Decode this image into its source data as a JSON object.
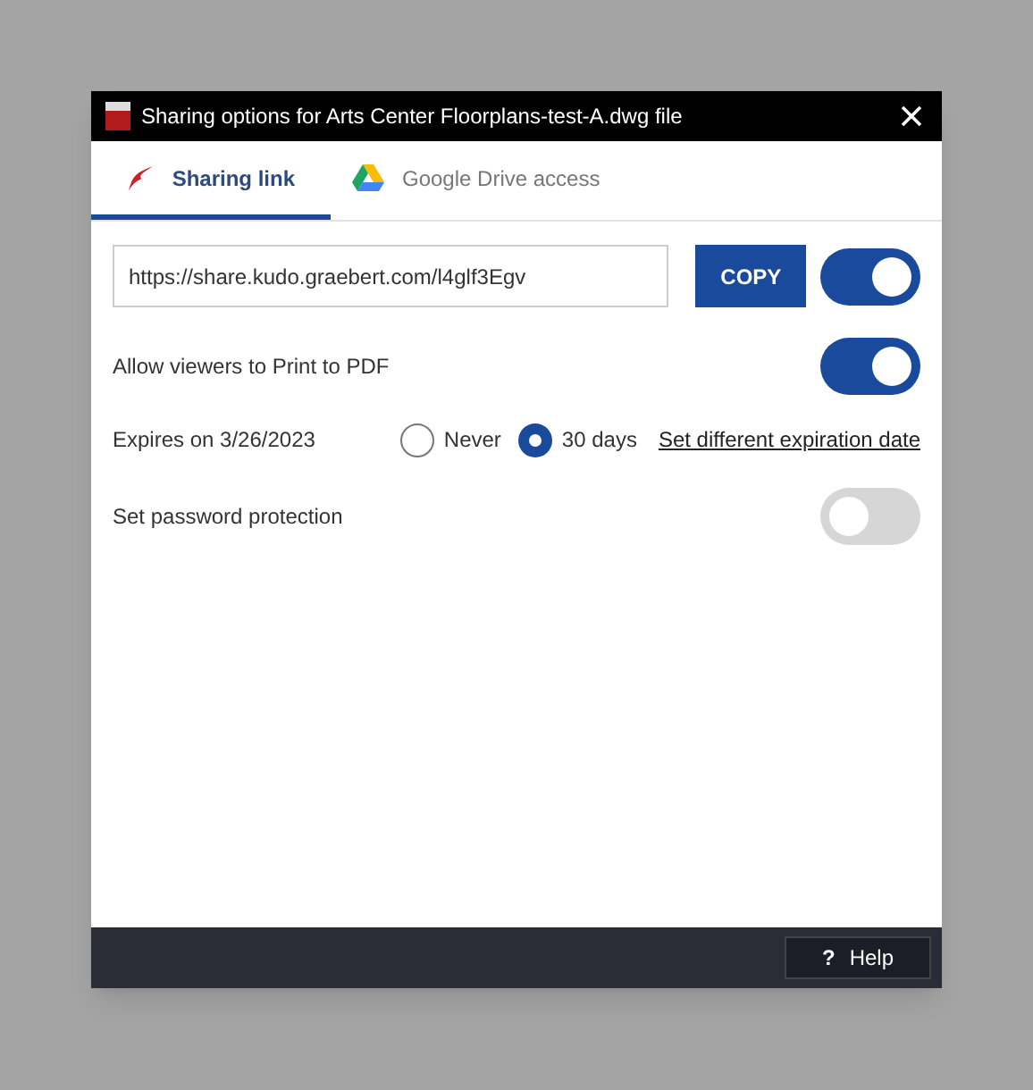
{
  "window": {
    "title": "Sharing options for Arts Center Floorplans-test-A.dwg file"
  },
  "tabs": [
    {
      "label": "Sharing link",
      "selected": true,
      "kind": "kudo"
    },
    {
      "label": "Google Drive access",
      "selected": false,
      "kind": "drive"
    }
  ],
  "link": {
    "value": "https://share.kudo.graebert.com/l4glf3Egv",
    "copy_label": "COPY",
    "on": true
  },
  "print_option": {
    "label": "Allow viewers to Print to PDF",
    "on": true
  },
  "expiry": {
    "label": "Expires on 3/26/2023",
    "options": [
      {
        "label": "Never",
        "selected": false
      },
      {
        "label": "30 days",
        "selected": true
      }
    ],
    "link": "Set different expiration date"
  },
  "password": {
    "label": "Set password protection",
    "on": false
  },
  "help_button": {
    "icon": "?",
    "label": "Help"
  }
}
